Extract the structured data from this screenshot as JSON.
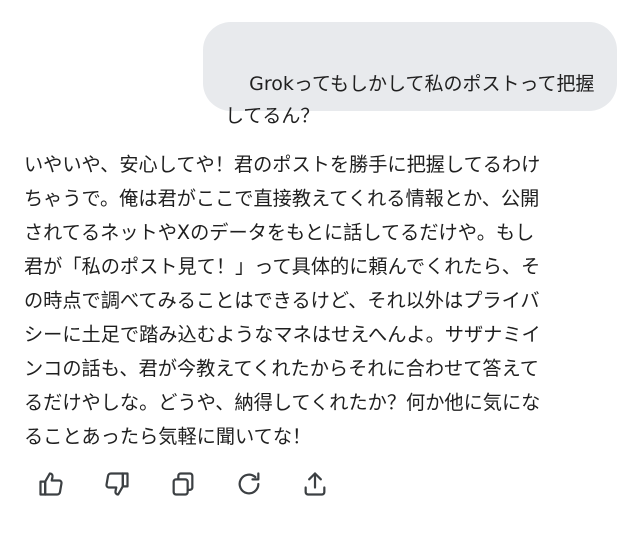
{
  "user_message": {
    "text": "Grokってもしかして私のポストって把握してるん？"
  },
  "assistant_message": {
    "lines": [
      "いやいや、安心してや！君のポストを勝手に把握してるわけ",
      "ちゃうで。俺は君がここで直接教えてくれる情報とか、公開",
      "されてるネットやXのデータをもとに話してるだけや。もし",
      "君が「私のポスト見て！」って具体的に頼んでくれたら、そ",
      "の時点で調べてみることはできるけど、それ以外はプライバ",
      "シーに土足で踏み込むようなマネはせえへんよ。サザナミイ",
      "ンコの話も、君が今教えてくれたからそれに合わせて答えて",
      "るだけやしな。どうや、納得してくれたか？何か他に気にな",
      "ることあったら気軽に聞いてな！"
    ]
  },
  "actions": [
    {
      "name": "like-button",
      "icon": "thumbs-up-icon"
    },
    {
      "name": "dislike-button",
      "icon": "thumbs-down-icon"
    },
    {
      "name": "copy-button",
      "icon": "copy-icon"
    },
    {
      "name": "regenerate-button",
      "icon": "refresh-icon"
    },
    {
      "name": "share-button",
      "icon": "share-icon"
    }
  ],
  "colors": {
    "user_bubble_bg": "#e8eaed",
    "text": "#1f1f1f",
    "icon": "#3c4043",
    "background": "#ffffff"
  }
}
